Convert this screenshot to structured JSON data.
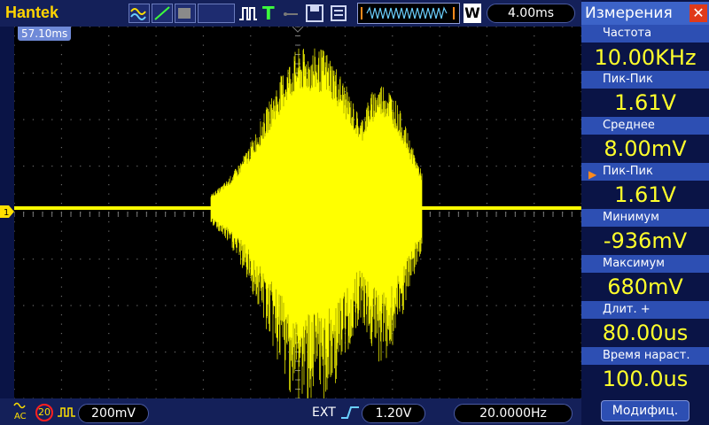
{
  "header": {
    "brand": "Hantek",
    "timebase": "4.00ms",
    "window_mode": "W"
  },
  "screen": {
    "time_offset": "57.10ms",
    "channel_marker": "1",
    "trace_color": "#ffff00"
  },
  "panel": {
    "title": "Измерения",
    "close_icon": "close-icon",
    "measurements": [
      {
        "label": "Частота",
        "value": "10.00KHz"
      },
      {
        "label": "Пик-Пик",
        "value": "1.61V"
      },
      {
        "label": "Среднее",
        "value": "8.00mV"
      },
      {
        "label": "Пик-Пик",
        "value": "1.61V"
      },
      {
        "label": "Минимум",
        "value": "-936mV"
      },
      {
        "label": "Максимум",
        "value": "680mV"
      },
      {
        "label": "Длит. +",
        "value": "80.00us"
      },
      {
        "label": "Время нараст.",
        "value": "100.0us"
      }
    ],
    "modify_button": "Модифиц."
  },
  "footer": {
    "coupling": "AC",
    "bw_limit": "20",
    "volts_div": "200mV",
    "trigger_source": "EXT",
    "trigger_level": "1.20V",
    "trigger_freq": "20.0000Hz"
  },
  "colors": {
    "trace": "#ffff00",
    "label_bg": "#2d4fb3",
    "value_text": "#ffff2a",
    "accent_orange": "#ff8a1c"
  }
}
